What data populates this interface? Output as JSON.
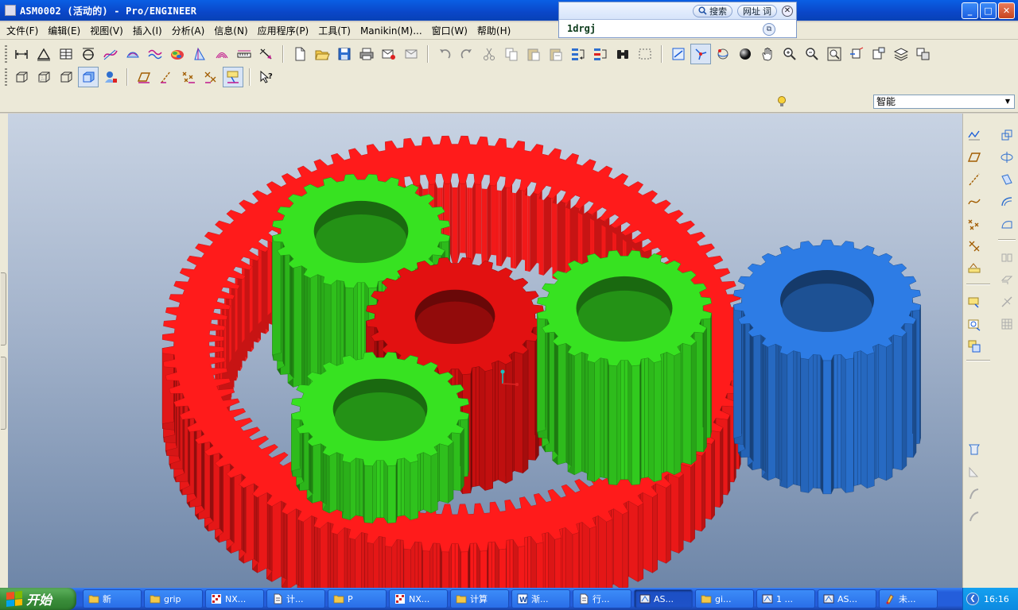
{
  "window": {
    "title": "ASM0002 (活动的) - Pro/ENGINEER",
    "buttons": {
      "minimize": "_",
      "maximize": "□",
      "close": "✕"
    }
  },
  "dictionary": {
    "search_label": "搜索",
    "web_label": "网址",
    "word_label": "词",
    "close": "✕",
    "query": "1drgj",
    "copy": "⧉"
  },
  "menu": [
    {
      "label": "文件(F)"
    },
    {
      "label": "编辑(E)"
    },
    {
      "label": "视图(V)"
    },
    {
      "label": "插入(I)"
    },
    {
      "label": "分析(A)"
    },
    {
      "label": "信息(N)"
    },
    {
      "label": "应用程序(P)"
    },
    {
      "label": "工具(T)"
    },
    {
      "label": "Manikin(M)..."
    },
    {
      "label": "窗口(W)"
    },
    {
      "label": "帮助(H)"
    }
  ],
  "filter": {
    "value": "智能",
    "arrow": "▼"
  },
  "taskbar": {
    "start_label": "开始",
    "tasks": [
      {
        "label": "新",
        "icon": "folder-icon",
        "width": 74
      },
      {
        "label": "grip",
        "icon": "folder-icon",
        "width": 74
      },
      {
        "label": "NX...",
        "icon": "nx-icon",
        "width": 74
      },
      {
        "label": "计...",
        "icon": "doc-icon",
        "width": 74
      },
      {
        "label": "P",
        "icon": "folder-icon",
        "width": 74
      },
      {
        "label": "NX...",
        "icon": "nx-icon",
        "width": 74
      },
      {
        "label": "计算",
        "icon": "folder-icon",
        "width": 74
      },
      {
        "label": "渐...",
        "icon": "word-icon",
        "width": 74
      },
      {
        "label": "行...",
        "icon": "doc-icon",
        "width": 74
      },
      {
        "label": "AS...",
        "icon": "proe-icon",
        "width": 74,
        "active": true
      },
      {
        "label": "gi...",
        "icon": "folder-icon",
        "width": 74
      },
      {
        "label": "1 ...",
        "icon": "proe-icon",
        "width": 74
      },
      {
        "label": "AS...",
        "icon": "proe-icon",
        "width": 74
      },
      {
        "label": "未...",
        "icon": "paint-icon",
        "width": 74
      }
    ],
    "clock": "16:16",
    "tray_chevron": "❮"
  },
  "colors": {
    "ring_gear": "#ff1a1a",
    "planet_gear": "#33d11f",
    "sun_gear": "#d11010",
    "external_gear": "#2a73d4",
    "titlebar": "#0a46c8",
    "taskbar": "#245edb"
  }
}
